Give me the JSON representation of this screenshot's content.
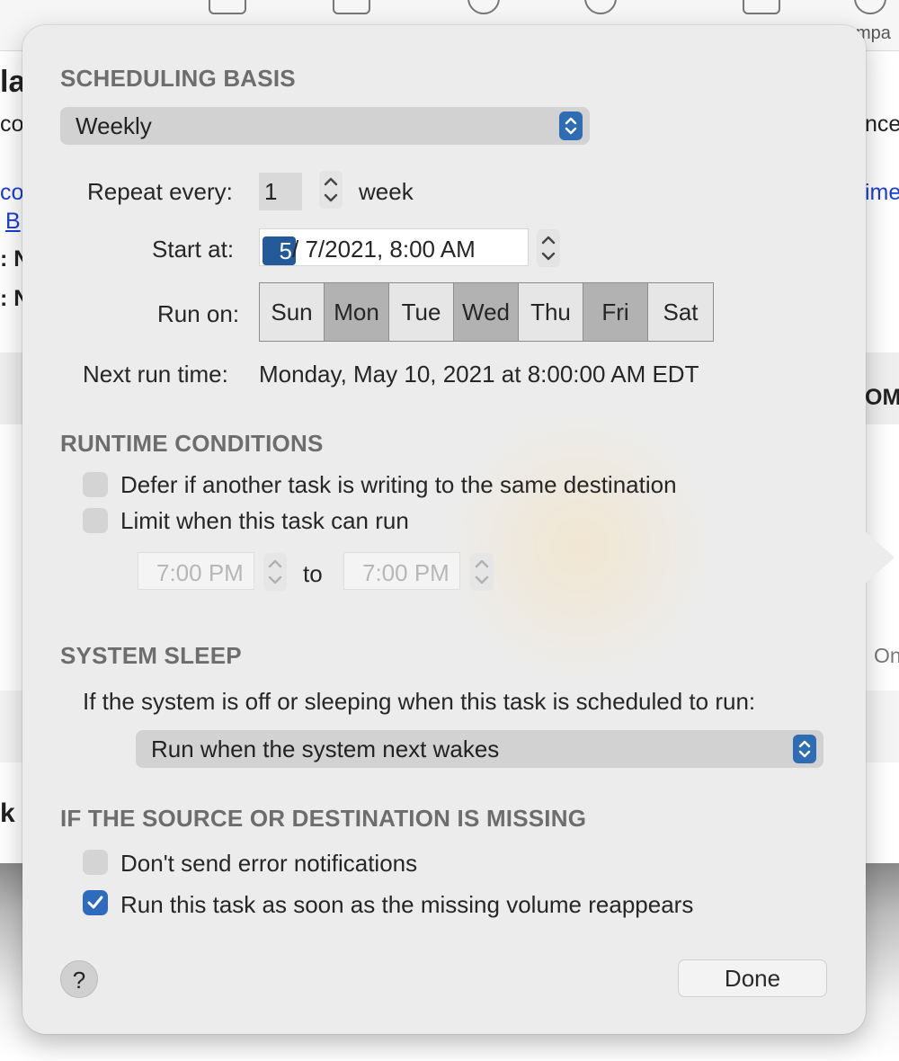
{
  "background": {
    "toolbar_right_label": "mpa",
    "left_fragments": [
      "la",
      "co",
      "co",
      "B",
      ": N",
      ": N",
      "k"
    ],
    "right_fragments": [
      "nce",
      "ime",
      "OM",
      "On"
    ]
  },
  "scheduling": {
    "title": "SCHEDULING BASIS",
    "basis_value": "Weekly",
    "repeat_label": "Repeat every:",
    "repeat_value": "1",
    "repeat_unit": "week",
    "start_label": "Start at:",
    "start_month": "5",
    "start_rest": "/  7/2021,   8:00 AM",
    "run_on_label": "Run on:",
    "days": [
      {
        "label": "Sun",
        "selected": false
      },
      {
        "label": "Mon",
        "selected": true
      },
      {
        "label": "Tue",
        "selected": false
      },
      {
        "label": "Wed",
        "selected": true
      },
      {
        "label": "Thu",
        "selected": false
      },
      {
        "label": "Fri",
        "selected": true
      },
      {
        "label": "Sat",
        "selected": false
      }
    ],
    "next_run_label": "Next run time:",
    "next_run_value": "Monday, May 10, 2021 at 8:00:00 AM EDT"
  },
  "runtime": {
    "title": "RUNTIME CONDITIONS",
    "defer_label": "Defer if another task is writing to the same destination",
    "defer_checked": false,
    "limit_label": "Limit when this task can run",
    "limit_checked": false,
    "from_time": "7:00 PM",
    "to_label": "to",
    "to_time": "7:00 PM"
  },
  "sleep": {
    "title": "SYSTEM SLEEP",
    "description": "If the system is off or sleeping when this task is scheduled to run:",
    "option_value": "Run when the system next wakes"
  },
  "missing": {
    "title": "IF THE SOURCE OR DESTINATION IS MISSING",
    "no_errors_label": "Don't send error notifications",
    "no_errors_checked": false,
    "run_on_reappear_label": "Run this task as soon as the missing volume reappears",
    "run_on_reappear_checked": true
  },
  "footer": {
    "help_label": "?",
    "done_label": "Done"
  },
  "colors": {
    "accent": "#2f6bbd",
    "popover_bg": "#ececec",
    "section_title": "#6d6d6d"
  }
}
